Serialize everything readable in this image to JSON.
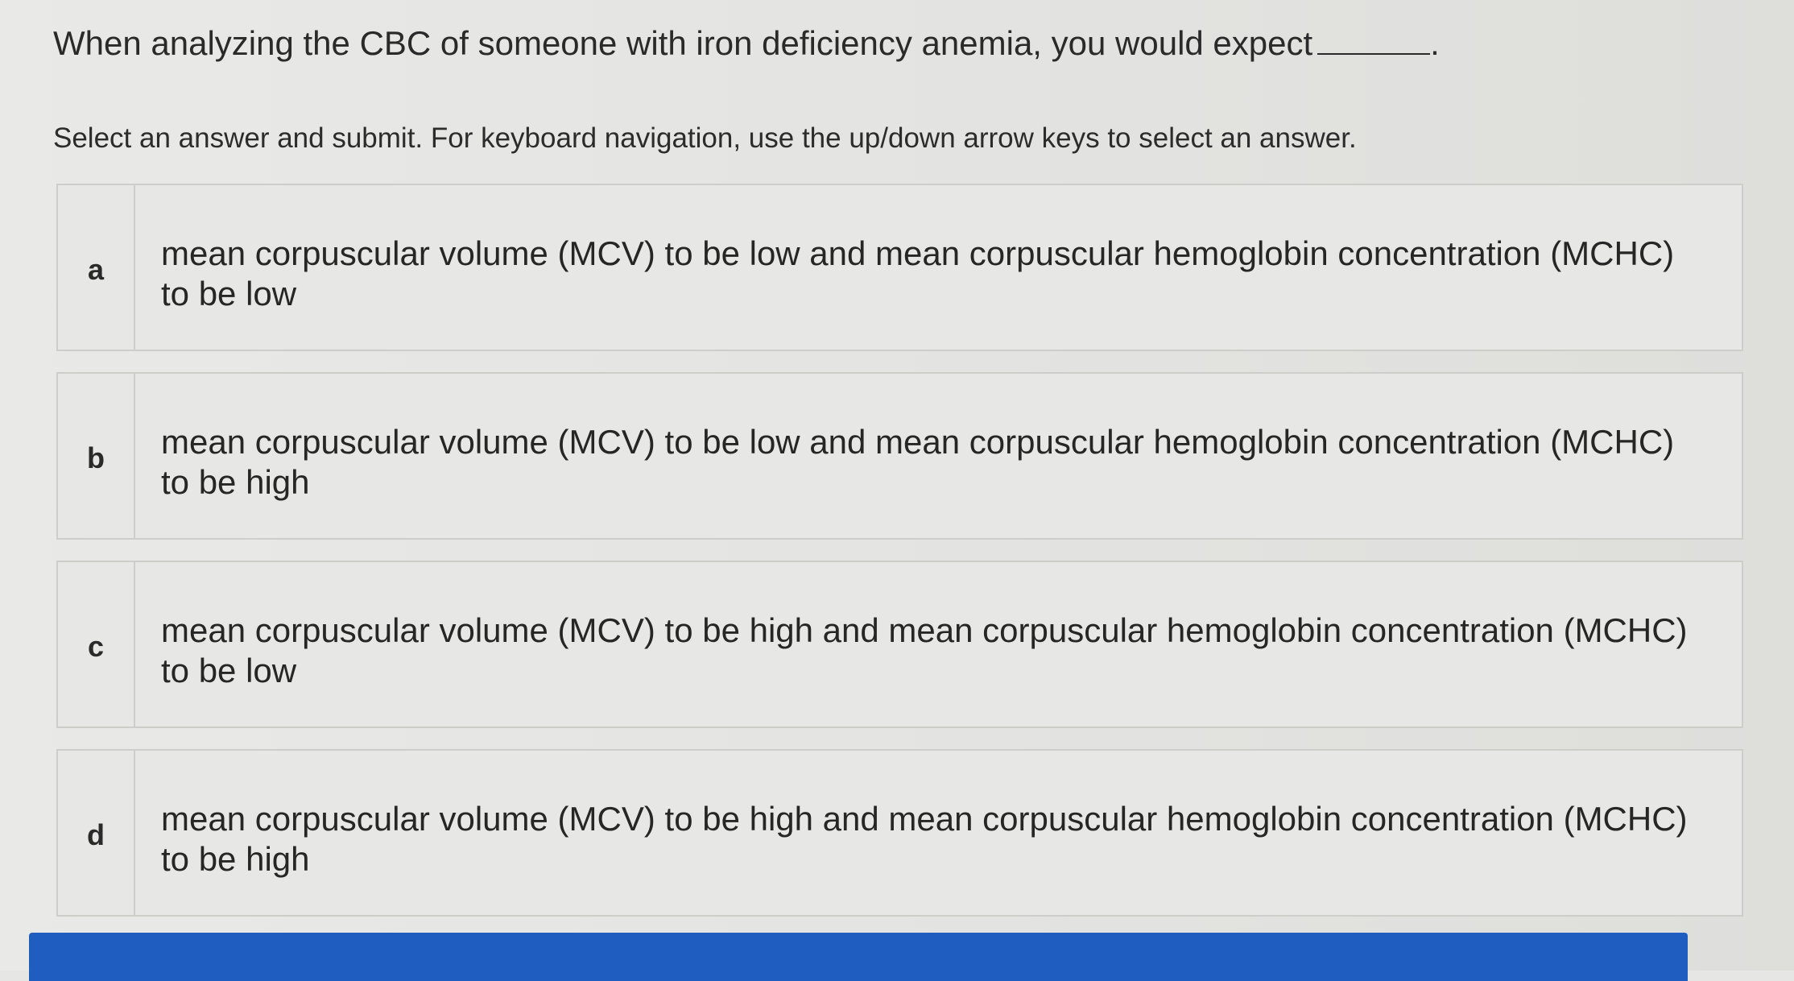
{
  "question": {
    "text": "When analyzing the CBC of someone with iron deficiency anemia, you would expect",
    "end": "."
  },
  "instructions": "Select an answer and submit. For keyboard navigation, use the up/down arrow keys to select an answer.",
  "answers": [
    {
      "letter": "a",
      "text": "mean corpuscular volume (MCV) to be low and mean corpuscular hemoglobin concentration (MCHC) to be low"
    },
    {
      "letter": "b",
      "text": "mean corpuscular volume (MCV) to be low and mean corpuscular hemoglobin concentration (MCHC) to be high"
    },
    {
      "letter": "c",
      "text": "mean corpuscular volume (MCV) to be high and mean corpuscular hemoglobin concentration (MCHC) to be low"
    },
    {
      "letter": "d",
      "text": "mean corpuscular volume (MCV) to be high and mean corpuscular hemoglobin concentration (MCHC) to be high"
    }
  ],
  "colors": {
    "submit_bar": "#1f5dc1",
    "border": "#cdcdca"
  }
}
